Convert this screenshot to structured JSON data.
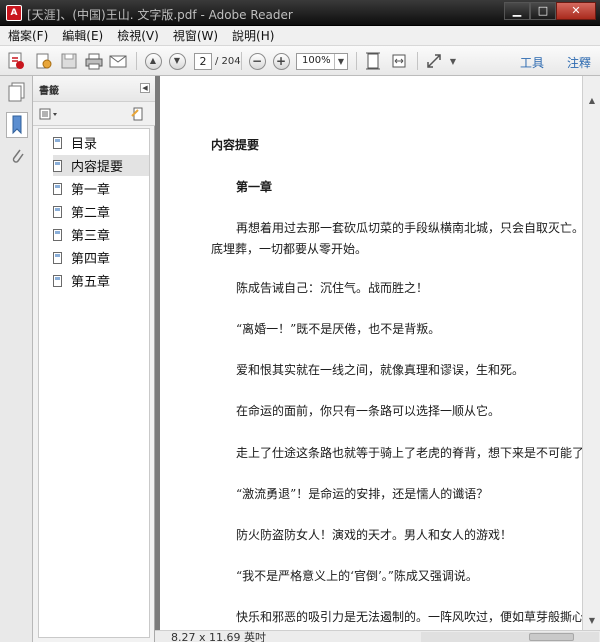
{
  "window": {
    "title": "[天涯]、(中国)王山. 文字版.pdf - Adobe Reader",
    "minimize_glyph": "▁",
    "maximize_glyph": "□",
    "close_glyph": "✕",
    "app_icon_glyph": "A"
  },
  "menu": {
    "items": [
      "檔案(F)",
      "編輯(E)",
      "檢視(V)",
      "視窗(W)",
      "說明(H)"
    ]
  },
  "toolbar": {
    "page_number": "2",
    "page_total": "/ 204",
    "zoom": "100%",
    "zoom_out_glyph": "−",
    "zoom_in_glyph": "+",
    "prev_glyph": "▲",
    "next_glyph": "▼",
    "tools_label": "工具",
    "comment_label": "注釋",
    "icons": [
      "create-pdf-icon",
      "edit-icon",
      "save-icon",
      "print-icon",
      "email-icon",
      "fit-page-icon",
      "fit-width-icon",
      "fullscreen-icon"
    ]
  },
  "bookmarks": {
    "header": "書籤",
    "items": [
      {
        "label": "目录"
      },
      {
        "label": "内容提要"
      },
      {
        "label": "第一章"
      },
      {
        "label": "第二章"
      },
      {
        "label": "第三章"
      },
      {
        "label": "第四章"
      },
      {
        "label": "第五章"
      }
    ],
    "selected_index": 1
  },
  "document": {
    "lines": [
      {
        "text": "内容提要",
        "bold": true
      },
      {
        "text": "第一章",
        "bold": true
      },
      {
        "text": "再想着用过去那一套砍瓜切菜的手段纵横南北城，只会自取灭亡。必"
      },
      {
        "text": "底埋葬，一切都要从零开始。"
      },
      {
        "text": "陈成告诫自己：沉住气。战而胜之！"
      },
      {
        "text": "“离婚一！”既不是厌倦，也不是背叛。"
      },
      {
        "text": "爱和恨其实就在一线之间，就像真理和谬误，生和死。"
      },
      {
        "text": "在命运的面前，你只有一条路可以选择一顺从它。"
      },
      {
        "text": "走上了仕途这条路也就等于骑上了老虎的脊背，想下来是不可能了。"
      },
      {
        "text": "“激流勇退”！是命运的安排，还是懦人的谶语？"
      },
      {
        "text": "防火防盗防女人！演戏的天才。男人和女人的游戏！"
      },
      {
        "text": "“我不是严格意义上的‘官倒’。”陈成又强调说。"
      },
      {
        "text": "快乐和邪恶的吸引力是无法遏制的。一阵风吹过，便如草芽般撕心"
      }
    ]
  },
  "status": {
    "page_size": "8.27 x 11.69 英吋"
  },
  "colors": {
    "title_bar": "#0d0d0d",
    "link": "#2d6ab0",
    "document_bg": "#7b7b7b",
    "page_bg": "#ffffff"
  }
}
